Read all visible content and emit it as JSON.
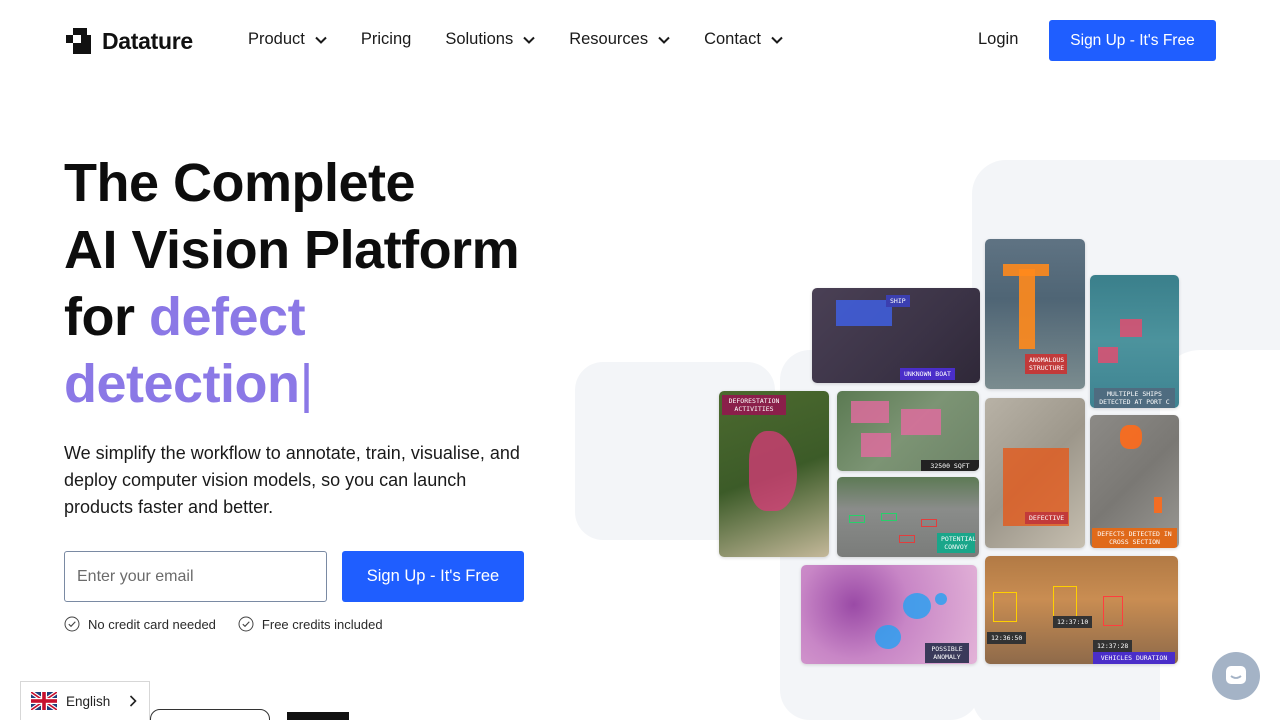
{
  "brand": {
    "name": "Datature",
    "primary_color": "#1f5eff",
    "accent_color": "#8b78e6"
  },
  "nav": {
    "items": [
      {
        "label": "Product",
        "has_dropdown": true
      },
      {
        "label": "Pricing",
        "has_dropdown": false
      },
      {
        "label": "Solutions",
        "has_dropdown": true
      },
      {
        "label": "Resources",
        "has_dropdown": true
      },
      {
        "label": "Contact",
        "has_dropdown": true
      }
    ],
    "login_label": "Login",
    "signup_label": "Sign Up - It's Free"
  },
  "hero": {
    "title_line1": "The Complete",
    "title_line2": "AI Vision Platform",
    "title_line3_prefix": "for ",
    "title_accent_1": "defect",
    "title_accent_2": "detection",
    "title_caret": "|",
    "subtitle": "We simplify the workflow to annotate, train, visualise, and deploy computer vision models, so you can launch products faster and better.",
    "email_placeholder": "Enter your email",
    "cta_label": "Sign Up - It's Free",
    "perks": [
      "No credit card needed",
      "Free credits included"
    ]
  },
  "collage": {
    "tags": {
      "ship": "SHIP",
      "unknown_boat": "UNKNOWN BOAT",
      "anomalous_structure": "ANOMALOUS STRUCTURE",
      "multiple_ships": "MULTIPLE SHIPS DETECTED AT PORT C",
      "deforestation": "DEFORESTATION ACTIVITIES",
      "roof": "32500 SQFT OF ROOF",
      "convoy": "POTENTIAL CONVOY",
      "defective": "DEFECTIVE",
      "defects_cross": "DEFECTS DETECTED IN CROSS SECTION",
      "anomaly": "POSSIBLE ANOMALY",
      "vehicles_duration": "VEHICLES DURATION",
      "t1": "12:36:50",
      "t2": "12:37:10",
      "t3": "12:37:28"
    }
  },
  "language": {
    "selected": "English",
    "icon": "uk-flag-icon"
  },
  "chat": {
    "icon": "chat-bubble-icon"
  }
}
